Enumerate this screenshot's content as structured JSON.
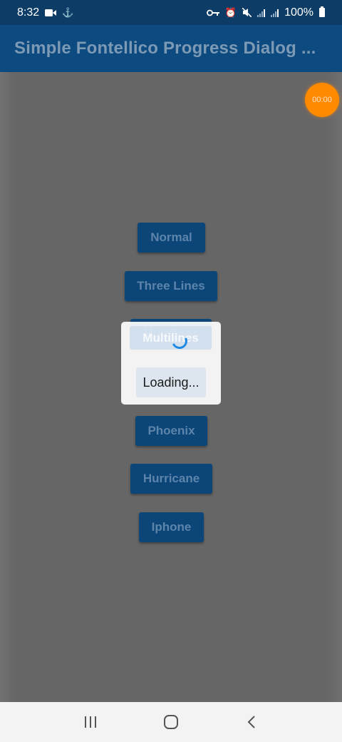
{
  "status_bar": {
    "time": "8:32",
    "battery_text": "100%",
    "left_icons": [
      "video-camera-icon",
      "anchor-icon"
    ],
    "right_icons": [
      "vpn-key-icon",
      "alarm-icon",
      "mute-icon",
      "signal-icon",
      "signal-icon",
      "battery-icon"
    ]
  },
  "app_bar": {
    "title": "Simple Fontellico Progress Dialog ..."
  },
  "timer": {
    "label": "00:00"
  },
  "buttons": {
    "normal": "Normal",
    "three_lines": "Three Lines",
    "multilines": "Multilines",
    "phoenix": "Phoenix",
    "hurricane": "Hurricane",
    "iphone": "Iphone"
  },
  "dialog": {
    "message": "Loading..."
  },
  "nav_bar": {
    "icons": [
      "recent-apps-icon",
      "home-icon",
      "back-icon"
    ]
  },
  "colors": {
    "app_bar": "#0d4a80",
    "button": "#0c4678",
    "spinner": "#1e88e5",
    "timer": "#ff8a00"
  }
}
